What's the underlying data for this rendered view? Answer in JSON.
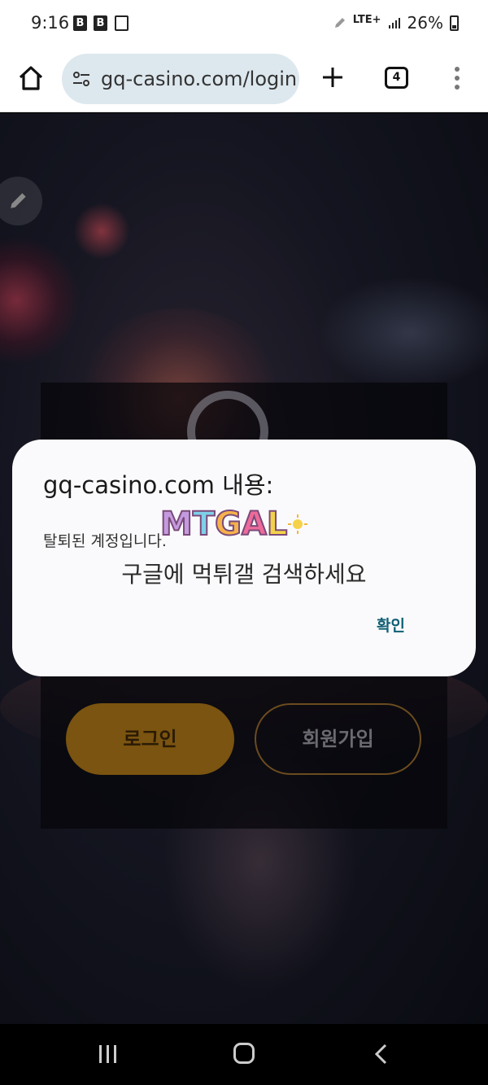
{
  "status_bar": {
    "time": "9:16",
    "notif_icons": [
      "B",
      "B"
    ],
    "network": "LTE+",
    "battery": "26%"
  },
  "browser": {
    "url": "gq-casino.com/login",
    "tab_count": "4"
  },
  "page": {
    "login_button": "로그인",
    "signup_button": "회원가입"
  },
  "dialog": {
    "title": "gq-casino.com 내용:",
    "message": "탈퇴된 계정입니다.",
    "overlay_text": "구글에 먹튀갤 검색하세요",
    "ok_button": "확인"
  },
  "watermark": {
    "letters": [
      "M",
      "T",
      "G",
      "A",
      "L"
    ],
    "colors": [
      "#c49adf",
      "#7fd0e8",
      "#f6b24a",
      "#ee6a9a",
      "#f2d24a"
    ]
  }
}
